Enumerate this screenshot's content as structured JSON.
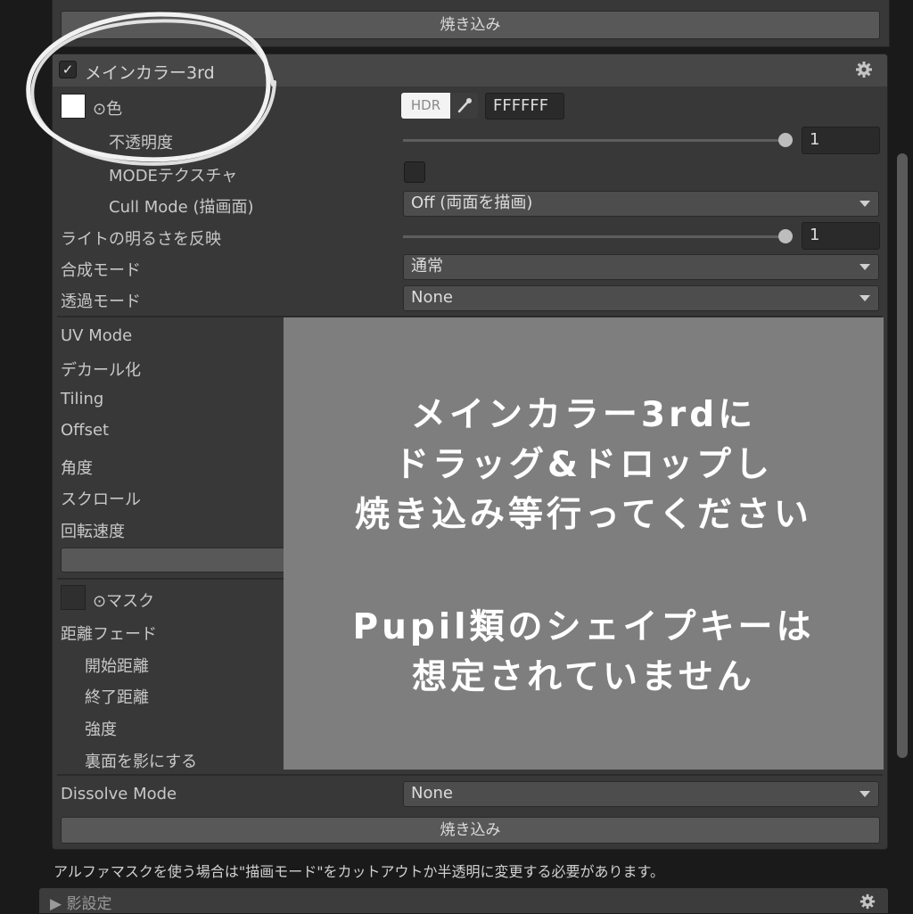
{
  "top": {
    "bake_button": "焼き込み"
  },
  "section": {
    "title": "メインカラー3rd",
    "enabled": true,
    "icons": {
      "gear": "gear-icon",
      "eyedropper": "eyedropper-icon",
      "check": "check-icon"
    }
  },
  "properties": {
    "color": {
      "label": "⊙色",
      "hdr": "HDR",
      "hex": "FFFFFF",
      "swatch_color": "#ffffff"
    },
    "opacity": {
      "label": "不透明度",
      "value": "1",
      "level": 1.0
    },
    "mode_texture": {
      "label": "MODEテクスチャ"
    },
    "cull_mode": {
      "label": "Cull Mode (描画面)",
      "value": "Off (両面を描画)"
    },
    "light_reflect": {
      "label": "ライトの明るさを反映",
      "value": "1",
      "level": 1.0
    },
    "blend_mode": {
      "label": "合成モード",
      "value": "通常"
    },
    "transparency_mode": {
      "label": "透過モード",
      "value": "None"
    },
    "uv_mode": {
      "label": "UV Mode"
    },
    "decal": {
      "label": "デカール化"
    },
    "tiling": {
      "label": "Tiling"
    },
    "offset": {
      "label": "Offset"
    },
    "angle": {
      "label": "角度"
    },
    "scroll": {
      "label": "スクロール"
    },
    "rotation_speed": {
      "label": "回転速度"
    },
    "mask": {
      "label": "⊙マスク"
    },
    "distance_fade": {
      "label": "距離フェード"
    },
    "fade_start": {
      "label": "開始距離"
    },
    "fade_end": {
      "label": "終了距離"
    },
    "strength": {
      "label": "強度"
    },
    "backface_shadow": {
      "label": "裏面を影にする"
    },
    "dissolve_mode": {
      "label": "Dissolve Mode",
      "value": "None"
    }
  },
  "bottom": {
    "bake_button": "焼き込み",
    "help_text": "アルファマスクを使う場合は\"描画モード\"をカットアウトか半透明に変更する必要があります。",
    "next_section": "▶ 影設定"
  },
  "overlay": {
    "lines": [
      "メインカラー3rdに",
      "ドラッグ&ドロップし",
      "焼き込み等行ってください",
      "Pupil類のシェイプキーは",
      "想定されていません"
    ]
  },
  "colors": {
    "background": "#1a1a1a",
    "panel": "#383838",
    "header": "#474747",
    "overlay": "#7e7e7e",
    "circle_annotation": "#f2f2f2"
  }
}
